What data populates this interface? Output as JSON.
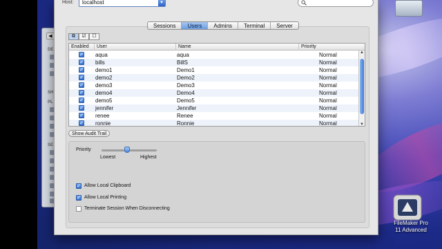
{
  "host": {
    "label": "Host:",
    "value": "localhost"
  },
  "search": {
    "placeholder": ""
  },
  "tabs": [
    {
      "label": "Sessions",
      "active": false
    },
    {
      "label": "Users",
      "active": true
    },
    {
      "label": "Admins",
      "active": false
    },
    {
      "label": "Terminal",
      "active": false
    },
    {
      "label": "Server",
      "active": false
    }
  ],
  "table": {
    "headers": {
      "enabled": "Enabled",
      "user": "User",
      "name": "Name",
      "priority": "Priority"
    },
    "rows": [
      {
        "user": "aqua",
        "name": "aqua",
        "priority": "Normal",
        "enabled": true
      },
      {
        "user": "bills",
        "name": "BillS",
        "priority": "Normal",
        "enabled": true
      },
      {
        "user": "demo1",
        "name": "Demo1",
        "priority": "Normal",
        "enabled": true
      },
      {
        "user": "demo2",
        "name": "Demo2",
        "priority": "Normal",
        "enabled": true
      },
      {
        "user": "demo3",
        "name": "Demo3",
        "priority": "Normal",
        "enabled": true
      },
      {
        "user": "demo4",
        "name": "Demo4",
        "priority": "Normal",
        "enabled": true
      },
      {
        "user": "demo5",
        "name": "Demo5",
        "priority": "Normal",
        "enabled": true
      },
      {
        "user": "jennifer",
        "name": "Jennifer",
        "priority": "Normal",
        "enabled": true
      },
      {
        "user": "renee",
        "name": "Renee",
        "priority": "Normal",
        "enabled": true
      },
      {
        "user": "ronnie",
        "name": "Ronnie",
        "priority": "Normal",
        "enabled": true
      }
    ]
  },
  "buttons": {
    "audit": "Show Audit Trail"
  },
  "settings": {
    "priority_label": "Priority",
    "lowest": "Lowest",
    "highest": "Highest",
    "priority_level": 0.5,
    "options": [
      {
        "label": "Allow Local Clipboard",
        "checked": true
      },
      {
        "label": "Allow Local Printing",
        "checked": true
      },
      {
        "label": "Terminate Session When Disconnecting",
        "checked": false
      }
    ]
  },
  "desktop": {
    "app_icon_label_1": "FileMaker Pro",
    "app_icon_label_2": "11 Advanced"
  },
  "colors": {
    "accent": "#3c78d8",
    "selected_tab": "#7aa7e4"
  }
}
